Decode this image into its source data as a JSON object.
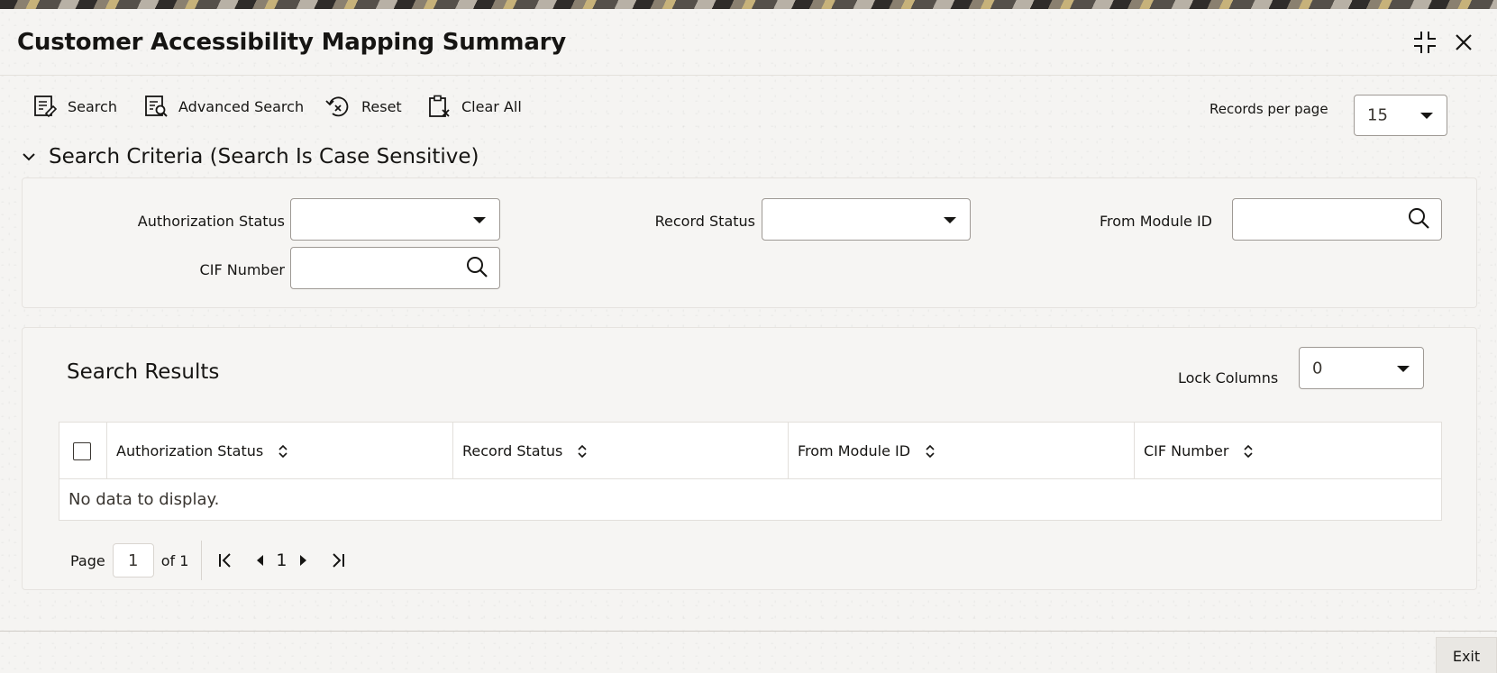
{
  "window": {
    "title": "Customer Accessibility Mapping Summary"
  },
  "toolbar": {
    "search_label": "Search",
    "advanced_search_label": "Advanced Search",
    "reset_label": "Reset",
    "clear_all_label": "Clear All",
    "records_per_page_label": "Records per page",
    "records_per_page_value": "15"
  },
  "criteria": {
    "header": "Search Criteria (Search Is Case Sensitive)",
    "fields": {
      "authorization_status": {
        "label": "Authorization Status",
        "value": ""
      },
      "record_status": {
        "label": "Record Status",
        "value": ""
      },
      "from_module_id": {
        "label": "From Module ID",
        "value": ""
      },
      "cif_number": {
        "label": "CIF Number",
        "value": ""
      }
    }
  },
  "results": {
    "title": "Search Results",
    "lock_columns_label": "Lock Columns",
    "lock_columns_value": "0",
    "columns": [
      "Authorization Status",
      "Record Status",
      "From Module ID",
      "CIF Number"
    ],
    "empty_message": "No data to display."
  },
  "pagination": {
    "page_label": "Page",
    "current_page": "1",
    "of_label": "of 1",
    "page_number": "1"
  },
  "footer": {
    "exit_label": "Exit"
  },
  "icons": {
    "maximize": "compress-icon",
    "close": "close-icon",
    "search": "search-doc-icon",
    "advanced_search": "advanced-search-icon",
    "reset": "reset-icon",
    "clear_all": "clipboard-clear-icon"
  }
}
